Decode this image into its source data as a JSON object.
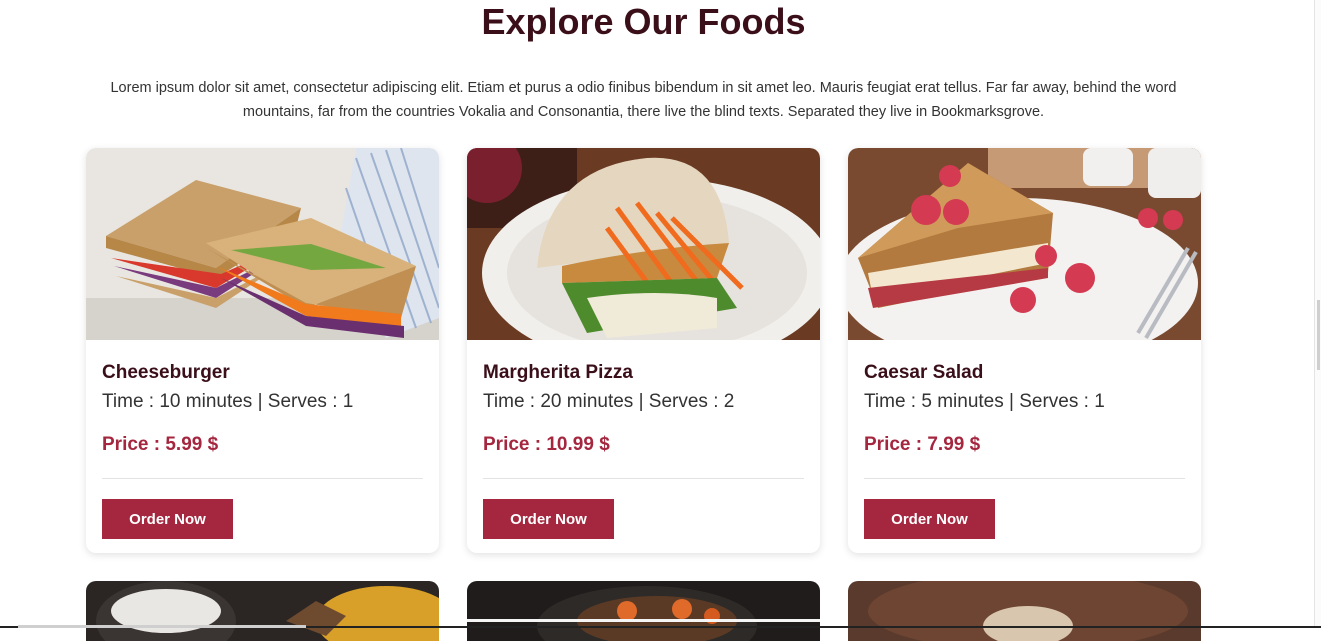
{
  "section": {
    "title": "Explore Our Foods",
    "intro": "Lorem ipsum dolor sit amet, consectetur adipiscing elit. Etiam et purus a odio finibus bibendum in sit amet leo. Mauris feugiat erat tellus. Far far away, behind the word mountains, far from the countries Vokalia and Consonantia, there live the blind texts. Separated they live in Bookmarksgrove."
  },
  "foods": [
    {
      "name": "Cheeseburger",
      "meta": "Time : 10 minutes | Serves : 1",
      "price": "Price : 5.99 $",
      "button": "Order Now"
    },
    {
      "name": "Margherita Pizza",
      "meta": "Time : 20 minutes | Serves : 2",
      "price": "Price : 10.99 $",
      "button": "Order Now"
    },
    {
      "name": "Caesar Salad",
      "meta": "Time : 5 minutes | Serves : 1",
      "price": "Price : 7.99 $",
      "button": "Order Now"
    }
  ],
  "colors": {
    "accent": "#a4273f",
    "heading": "#3b0f1a"
  }
}
